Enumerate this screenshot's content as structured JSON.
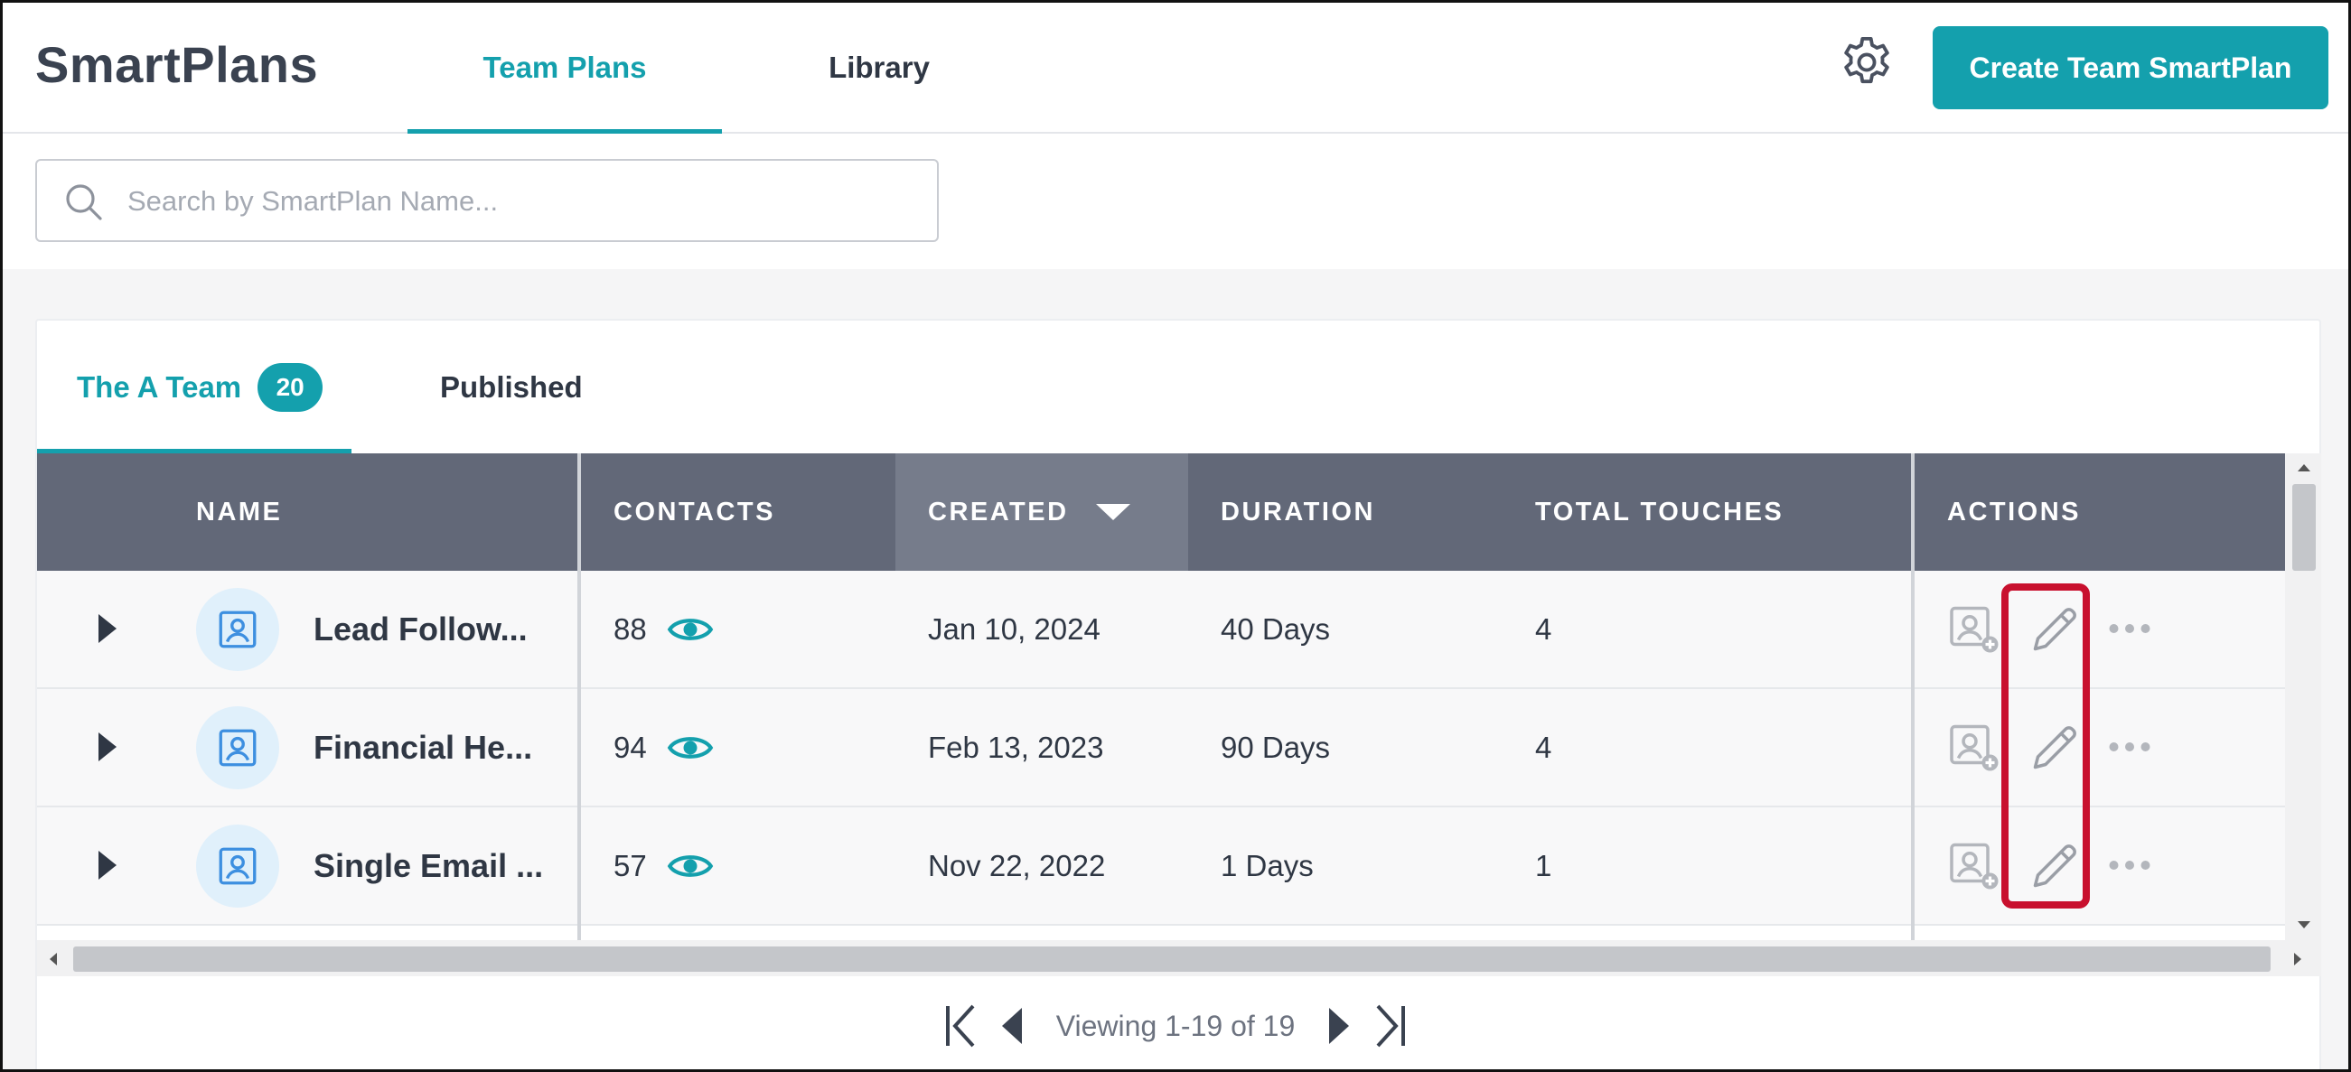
{
  "header": {
    "brand": "SmartPlans",
    "tabs": [
      {
        "label": "Team Plans",
        "active": true
      },
      {
        "label": "Library",
        "active": false
      }
    ],
    "create_button": "Create Team SmartPlan"
  },
  "search": {
    "placeholder": "Search by SmartPlan Name...",
    "value": ""
  },
  "subtabs": [
    {
      "label": "The A Team",
      "count": "20",
      "active": true
    },
    {
      "label": "Published",
      "active": false
    }
  ],
  "table": {
    "columns": {
      "name": "NAME",
      "contacts": "CONTACTS",
      "created": "CREATED",
      "duration": "DURATION",
      "touches": "TOTAL TOUCHES",
      "actions": "ACTIONS"
    },
    "sorted_column": "CREATED",
    "rows": [
      {
        "name": "Lead Follow...",
        "contacts": "88",
        "created": "Jan 10, 2024",
        "duration": "40 Days",
        "touches": "4"
      },
      {
        "name": "Financial He...",
        "contacts": "94",
        "created": "Feb 13, 2023",
        "duration": "90 Days",
        "touches": "4"
      },
      {
        "name": "Single Email ...",
        "contacts": "57",
        "created": "Nov 22, 2022",
        "duration": "1 Days",
        "touches": "1"
      }
    ]
  },
  "pager": {
    "text": "Viewing 1-19 of 19"
  },
  "colors": {
    "accent": "#14a0ad",
    "header_bg": "#626878",
    "highlight": "#c8102e",
    "avatar_bg": "#e0f0fb",
    "avatar_icon": "#3d8fe0"
  },
  "icons": [
    "search-icon",
    "gear-icon",
    "caret-right-icon",
    "plan-contact-icon",
    "eye-icon",
    "add-contact-icon",
    "pencil-icon",
    "more-icon",
    "first-page-icon",
    "prev-page-icon",
    "next-page-icon",
    "last-page-icon"
  ]
}
